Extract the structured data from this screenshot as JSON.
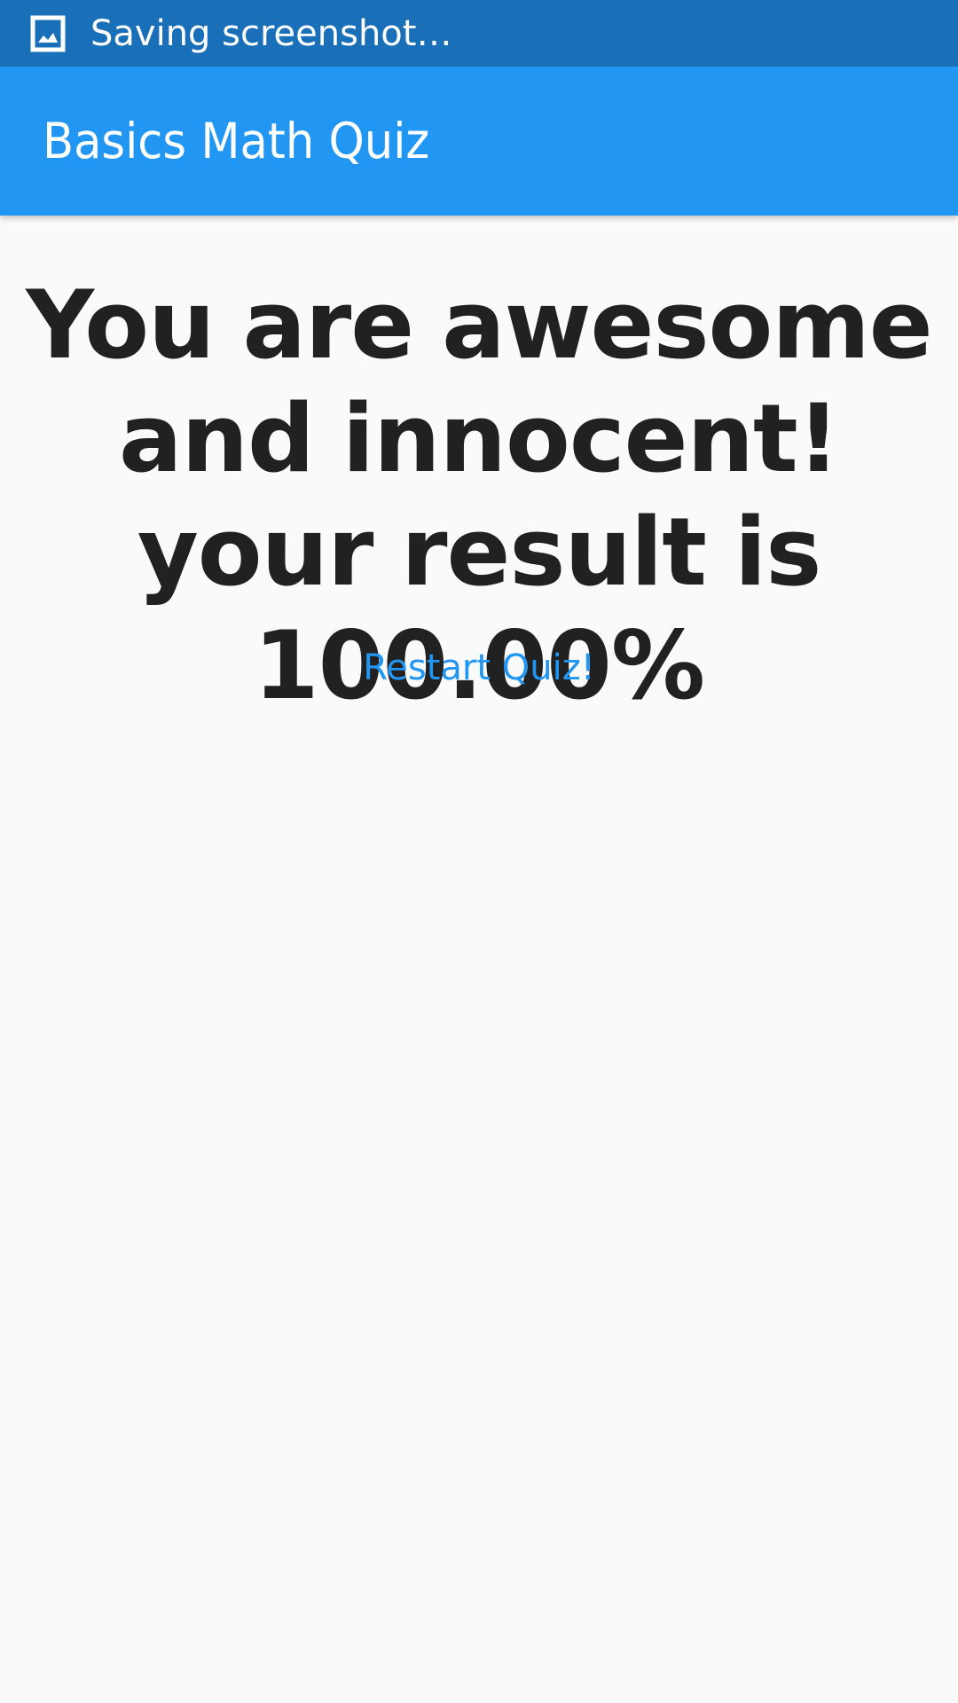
{
  "status_bar": {
    "icon": "image-icon",
    "text": "Saving screenshot…",
    "background": "#1a70b8"
  },
  "app_bar": {
    "title": "Basics Math Quiz",
    "background": "#2196f3"
  },
  "result": {
    "message": "You are awesome and innocent! your result is 100.00%"
  },
  "restart": {
    "label": "Restart Quiz!",
    "color": "#2196f3"
  }
}
